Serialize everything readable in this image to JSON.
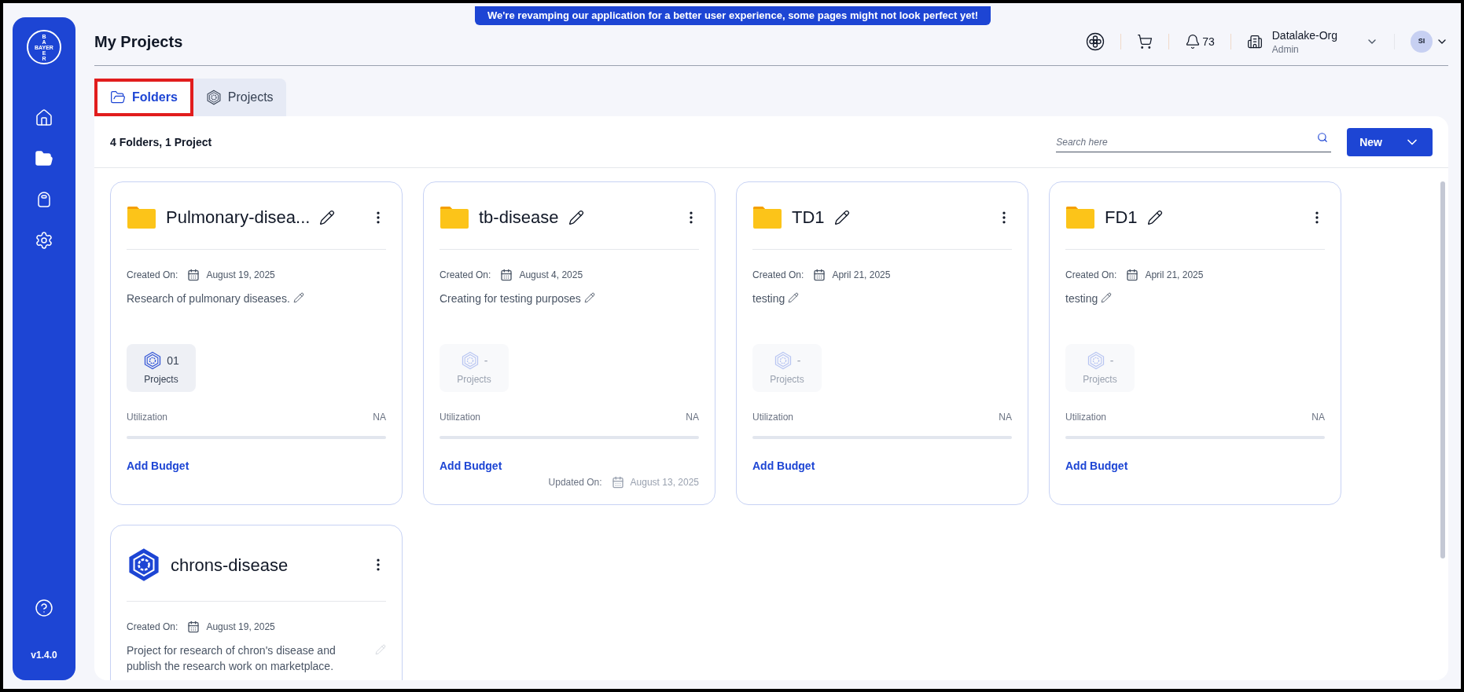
{
  "banner": "We're revamping our application for a better user experience, some pages might not look perfect yet!",
  "sidebar": {
    "logo": [
      "B",
      "A",
      "BAYER",
      "E",
      "R"
    ],
    "items": [
      {
        "selected": false
      },
      {
        "selected": true
      },
      {
        "selected": false
      },
      {
        "selected": false
      }
    ],
    "version": "v1.4.0"
  },
  "header": {
    "title": "My Projects",
    "notifications": "73",
    "org": {
      "name": "Datalake-Org",
      "role": "Admin"
    },
    "avatar": "SI"
  },
  "tabs": [
    {
      "label": "Folders",
      "selected": true,
      "highlighted": true
    },
    {
      "label": "Projects",
      "selected": false,
      "highlighted": false
    }
  ],
  "toolbar": {
    "summary": "4 Folders, 1 Project",
    "search": {
      "placeholder": "Search here"
    },
    "new_button": "New"
  },
  "cards": [
    {
      "kind": "folder",
      "title": "Pulmonary-disea...",
      "created_label": "Created On:",
      "created": "August 19, 2025",
      "description": "Research of pulmonary diseases.",
      "projects": {
        "count": "01",
        "label": "Projects",
        "disabled": false
      },
      "utilization_label": "Utilization",
      "utilization": "NA",
      "add_budget": "Add Budget"
    },
    {
      "kind": "folder",
      "title": "tb-disease",
      "created_label": "Created On:",
      "created": "August 4, 2025",
      "description": "Creating for testing purposes",
      "projects": {
        "count": "-",
        "label": "Projects",
        "disabled": true
      },
      "utilization_label": "Utilization",
      "utilization": "NA",
      "add_budget": "Add Budget",
      "updated_label": "Updated On:",
      "updated": "August 13, 2025"
    },
    {
      "kind": "folder",
      "title": "TD1",
      "created_label": "Created On:",
      "created": "April 21, 2025",
      "description": "testing",
      "projects": {
        "count": "-",
        "label": "Projects",
        "disabled": true
      },
      "utilization_label": "Utilization",
      "utilization": "NA",
      "add_budget": "Add Budget"
    },
    {
      "kind": "folder",
      "title": "FD1",
      "created_label": "Created On:",
      "created": "April 21, 2025",
      "description": "testing",
      "projects": {
        "count": "-",
        "label": "Projects",
        "disabled": true
      },
      "utilization_label": "Utilization",
      "utilization": "NA",
      "add_budget": "Add Budget"
    },
    {
      "kind": "project",
      "title": "chrons-disease",
      "created_label": "Created On:",
      "created": "August 19, 2025",
      "description": "Project for research of chron's disease and publish the research work on marketplace."
    }
  ]
}
